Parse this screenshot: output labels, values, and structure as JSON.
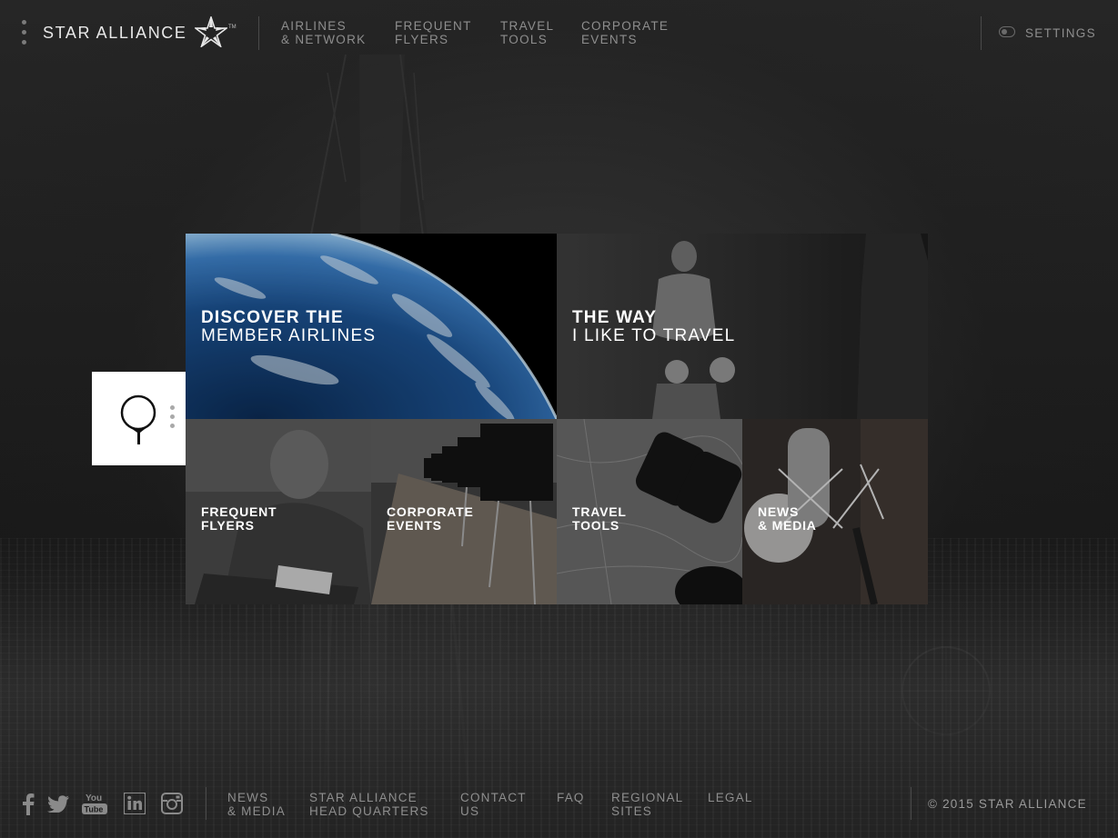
{
  "brand": {
    "name": "STAR ALLIANCE",
    "trademark": "TM"
  },
  "topnav": {
    "items": [
      {
        "line1": "AIRLINES",
        "line2": "& NETWORK"
      },
      {
        "line1": "FREQUENT",
        "line2": "FLYERS"
      },
      {
        "line1": "TRAVEL",
        "line2": "TOOLS"
      },
      {
        "line1": "CORPORATE",
        "line2": "EVENTS"
      }
    ],
    "settings_label": "SETTINGS"
  },
  "tiles": {
    "discover": {
      "line1": "DISCOVER THE",
      "line2": "MEMBER AIRLINES"
    },
    "theway": {
      "line1": "THE WAY",
      "line2": "I LIKE TO TRAVEL"
    },
    "frequent": {
      "line1": "FREQUENT",
      "line2": "FLYERS"
    },
    "corporate": {
      "line1": "CORPORATE",
      "line2": "EVENTS"
    },
    "travel": {
      "line1": "TRAVEL",
      "line2": "TOOLS"
    },
    "news": {
      "line1": "NEWS",
      "line2": "& MEDIA"
    }
  },
  "footer": {
    "social_icons": [
      "facebook-icon",
      "twitter-icon",
      "youtube-icon",
      "linkedin-icon",
      "instagram-icon"
    ],
    "links": [
      {
        "line1": "NEWS",
        "line2": "& MEDIA"
      },
      {
        "line1": "STAR ALLIANCE",
        "line2": "HEAD QUARTERS"
      },
      {
        "line1": "CONTACT",
        "line2": "US"
      },
      {
        "line1": "FAQ",
        "line2": ""
      },
      {
        "line1": "REGIONAL",
        "line2": "SITES"
      },
      {
        "line1": "LEGAL",
        "line2": ""
      }
    ],
    "copyright": "© 2015 STAR ALLIANCE"
  },
  "colors": {
    "background": "#1b1b1b",
    "text_muted": "#8e8e8e",
    "text_bright": "#ffffff",
    "panel": "#ffffff"
  }
}
